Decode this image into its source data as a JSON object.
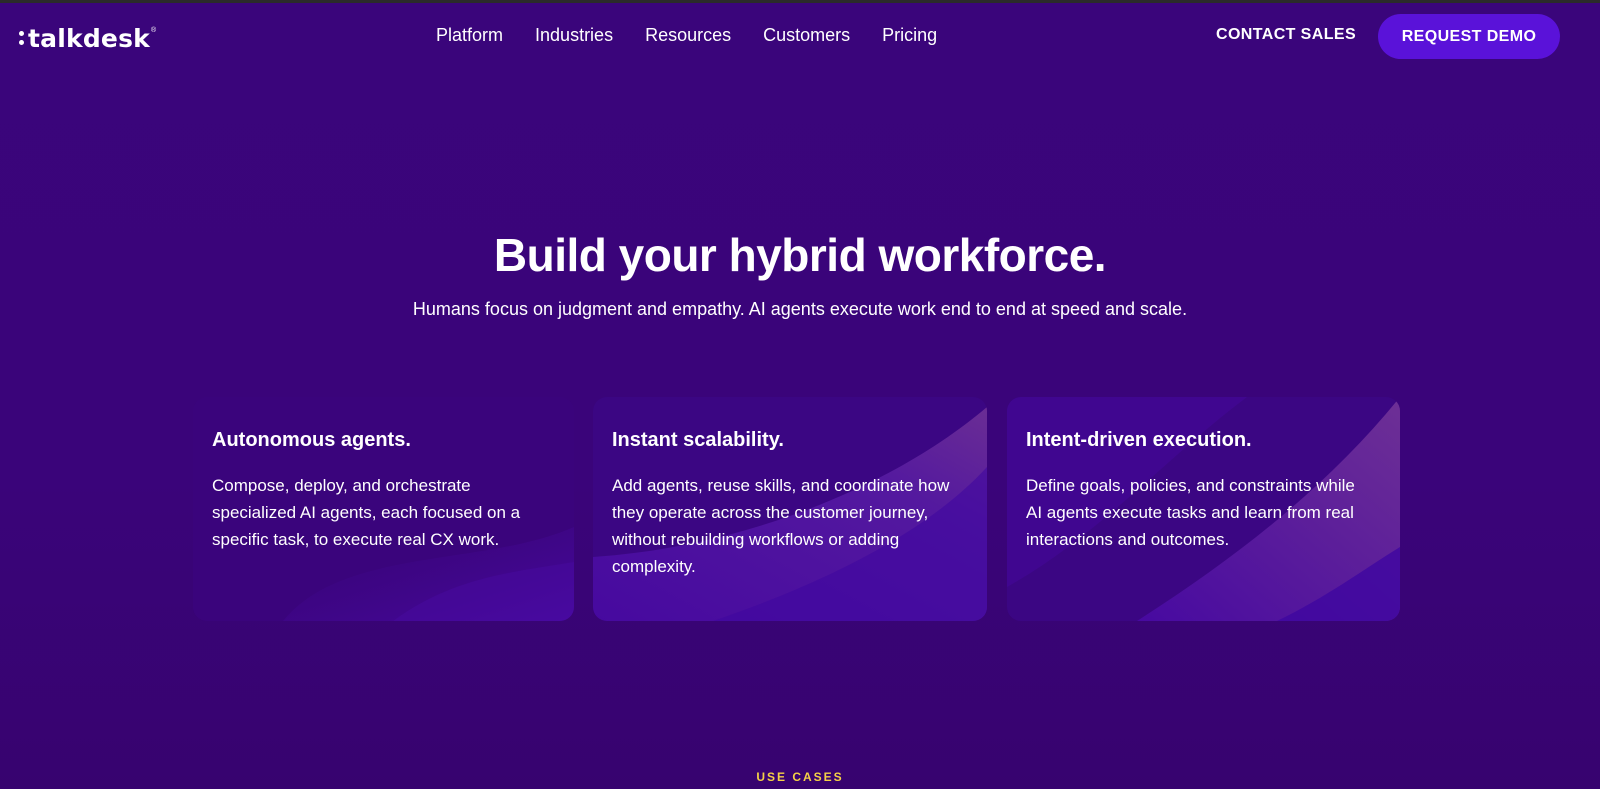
{
  "header": {
    "logo_text": "talkdesk",
    "logo_mark": "®",
    "nav": [
      "Platform",
      "Industries",
      "Resources",
      "Customers",
      "Pricing"
    ],
    "contact_label": "CONTACT SALES",
    "demo_label": "REQUEST DEMO"
  },
  "hero": {
    "title": "Build your hybrid workforce.",
    "subtitle": "Humans focus on judgment and empathy. AI agents execute work end to end at speed and scale."
  },
  "cards": [
    {
      "title": "Autonomous agents.",
      "body": "Compose, deploy, and orchestrate specialized AI agents, each focused on a specific task, to execute real CX work."
    },
    {
      "title": "Instant scalability.",
      "body": "Add agents, reuse skills, and coordinate how they operate across the customer journey, without rebuilding workflows or adding complexity."
    },
    {
      "title": "Intent-driven execution.",
      "body": "Define goals, policies, and constraints while AI agents execute tasks and learn from real interactions and outcomes."
    }
  ],
  "section_label": "USE CASES",
  "colors": {
    "background": "#39037a",
    "button": "#5a12d9",
    "accent_label": "#f5d146"
  }
}
